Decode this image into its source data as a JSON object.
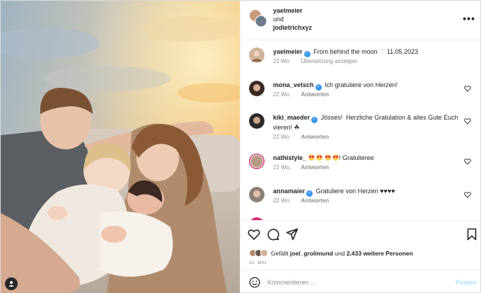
{
  "header": {
    "user1": "yaelmeier",
    "connector": "und",
    "user2": "jodietrichxyz",
    "more_icon": "more-horizontal-icon"
  },
  "caption": {
    "user": "yaelmeier",
    "text": "From behind the moon",
    "date": "11.05.2023",
    "age": "22 Wo.",
    "translate": "Übersetzung anzeigen"
  },
  "comments": [
    {
      "user": "mona_vetsch",
      "verified": true,
      "text": "Ich gratuliere von Herzen!",
      "age": "22 Wo.",
      "reply": "Antworten"
    },
    {
      "user": "kiki_maeder",
      "verified": true,
      "text": "Jösses!  Herzliche Gratulation & alles Gute Euch vieren! ☘",
      "age": "22 Wo.",
      "reply": "Antworten"
    },
    {
      "user": "nathistyle_",
      "verified": false,
      "text": "! Gratulieree",
      "age": "22 Wo.",
      "reply": "Antworten"
    },
    {
      "user": "annamaier",
      "verified": true,
      "text": "Gratuliere von Herzen ♥♥♥♥",
      "age": "22 Wo.",
      "reply": "Antworten"
    }
  ],
  "likes": {
    "prefix": "Gefällt",
    "user": "joel_grolimund",
    "mid": "und",
    "count": "2.433 weitere Personen"
  },
  "date": "31. MAI",
  "composer": {
    "placeholder": "Kommentieren ...",
    "post": "Posten"
  },
  "colors": {
    "verified": "#3897f0",
    "post_disabled": "#b2dffc",
    "muted": "#8e8e8e"
  }
}
